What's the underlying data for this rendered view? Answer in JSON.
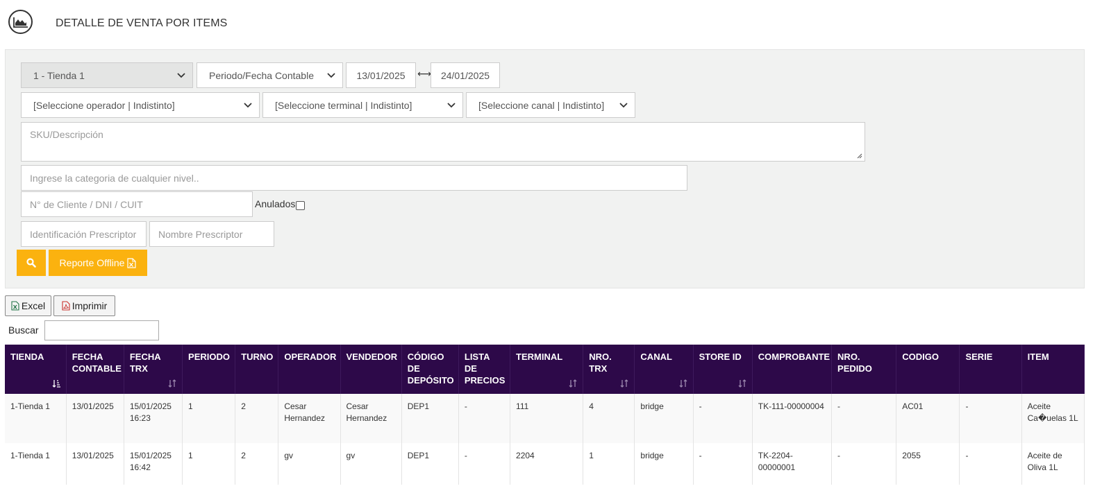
{
  "header": {
    "title": "DETALLE DE VENTA POR ITEMS",
    "icon": "area-chart-icon"
  },
  "filters": {
    "store_select": "1 - Tienda 1",
    "period_select": "Periodo/Fecha Contable",
    "date_from": "13/01/2025",
    "date_range_arrow": "⟷",
    "date_to": "24/01/2025",
    "operator_select": "[Seleccione operador | Indistinto]",
    "terminal_select": "[Seleccione terminal | Indistinto]",
    "channel_select": "[Seleccione canal | Indistinto]",
    "sku_placeholder": "SKU/Descripción",
    "category_placeholder": "Ingrese la categoria de cualquier nivel..",
    "client_placeholder": "N° de Cliente / DNI / CUIT",
    "anulados_label": "Anulados",
    "anulados_checked": false,
    "prescriptor_id_placeholder": "Identificación Prescriptor",
    "prescriptor_name_placeholder": "Nombre Prescriptor",
    "search_button_icon": "search-icon",
    "offline_report_label": "Reporte Offline"
  },
  "toolbar": {
    "excel_label": "Excel",
    "print_label": "Imprimir",
    "search_label": "Buscar",
    "search_value": ""
  },
  "table": {
    "columns": [
      "TIENDA",
      "FECHA CONTABLE",
      "FECHA TRX",
      "PERIODO",
      "TURNO",
      "OPERADOR",
      "VENDEDOR",
      "CÓDIGO DE DEPÓSITO",
      "LISTA DE PRECIOS",
      "TERMINAL",
      "NRO. TRX",
      "CANAL",
      "STORE ID",
      "COMPROBANTE",
      "NRO. PEDIDO",
      "CODIGO",
      "SERIE",
      "ITEM"
    ],
    "rows": [
      [
        "1-Tienda 1",
        "13/01/2025",
        "15/01/2025 16:23",
        "1",
        "2",
        "Cesar Hernandez",
        "Cesar Hernandez",
        "DEP1",
        "-",
        "111",
        "4",
        "bridge",
        "-",
        "TK-111-00000004",
        "-",
        "AC01",
        "-",
        "Aceite Ca�uelas 1L"
      ],
      [
        "1-Tienda 1",
        "13/01/2025",
        "15/01/2025 16:42",
        "1",
        "2",
        "gv",
        "gv",
        "DEP1",
        "-",
        "2204",
        "1",
        "bridge",
        "-",
        "TK-2204-00000001",
        "-",
        "2055",
        "-",
        "Aceite de Oliva 1L"
      ]
    ]
  },
  "colors": {
    "table_header_bg": "#2d0949",
    "accent_orange": "#fbb20f",
    "panel_bg": "#f1f2f1"
  }
}
